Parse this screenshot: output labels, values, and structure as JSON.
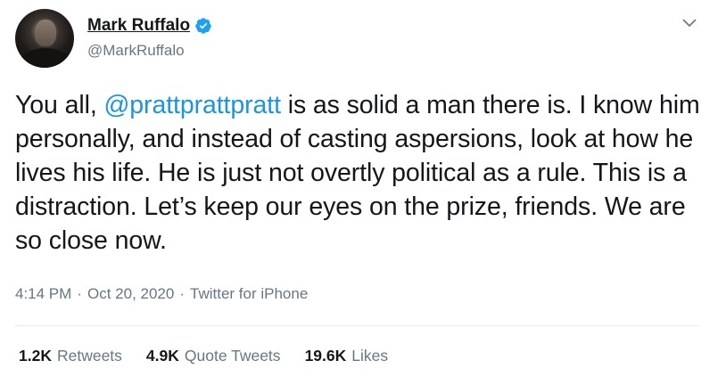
{
  "author": {
    "display_name": "Mark Ruffalo",
    "handle": "@MarkRuffalo",
    "verified": true
  },
  "tweet": {
    "text_before": "You all, ",
    "mention": "@prattprattpratt",
    "text_after": " is as solid a man there is. I know him personally, and instead of casting aspersions, look at how he lives his life. He is just not overtly political as a rule. This is a distraction. Let’s keep our eyes on the prize, friends. We are so close now.",
    "time": "4:14 PM",
    "separator": "·",
    "date": "Oct 20, 2020",
    "source": "Twitter for iPhone"
  },
  "stats": [
    {
      "count": "1.2K",
      "label": "Retweets"
    },
    {
      "count": "4.9K",
      "label": "Quote Tweets"
    },
    {
      "count": "19.6K",
      "label": "Likes"
    }
  ],
  "colors": {
    "link": "#1b95e0",
    "secondary_text": "#657786",
    "primary_text": "#14171a",
    "verified": "#1da1f2"
  },
  "icons": {
    "verified": "verified-badge-icon",
    "more": "chevron-down-icon"
  }
}
